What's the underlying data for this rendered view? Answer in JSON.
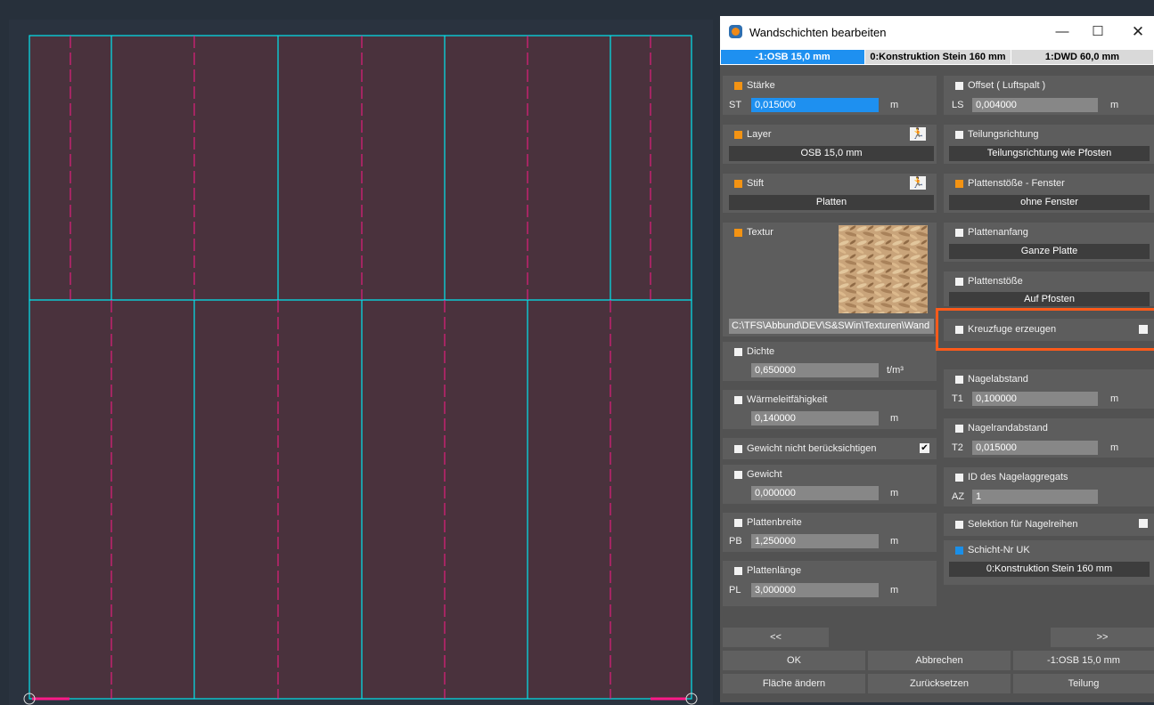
{
  "window": {
    "title": "Wandschichten bearbeiten",
    "minimize": "—",
    "maximize": "☐",
    "close": "✕"
  },
  "tabs": [
    {
      "label": "-1:OSB 15,0 mm",
      "active": true
    },
    {
      "label": "0:Konstruktion Stein 160 mm",
      "active": false
    },
    {
      "label": "1:DWD 60,0 mm",
      "active": false
    }
  ],
  "left": {
    "staerke": {
      "label": "Stärke",
      "prefix": "ST",
      "value": "0,015000",
      "unit": "m"
    },
    "layer": {
      "label": "Layer",
      "value": "OSB 15,0 mm"
    },
    "stift": {
      "label": "Stift",
      "value": "Platten"
    },
    "textur": {
      "label": "Textur",
      "path": "C:\\TFS\\Abbund\\DEV\\S&SWin\\Texturen\\Wand"
    },
    "dichte": {
      "label": "Dichte",
      "value": "0,650000",
      "unit": "t/m³"
    },
    "waerme": {
      "label": "Wärmeleitfähigkeit",
      "value": "0,140000",
      "unit": "m"
    },
    "gewicht_nicht": {
      "label": "Gewicht nicht berücksichtigen",
      "check": "✔"
    },
    "gewicht": {
      "label": "Gewicht",
      "value": "0,000000",
      "unit": "m"
    },
    "plattenbreite": {
      "label": "Plattenbreite",
      "prefix": "PB",
      "value": "1,250000",
      "unit": "m"
    },
    "plattenlaenge": {
      "label": "Plattenlänge",
      "prefix": "PL",
      "value": "3,000000",
      "unit": "m"
    }
  },
  "right": {
    "offset": {
      "label": "Offset ( Luftspalt )",
      "prefix": "LS",
      "value": "0,004000",
      "unit": "m"
    },
    "teilungsrichtung": {
      "label": "Teilungsrichtung",
      "value": "Teilungsrichtung wie Pfosten"
    },
    "plattenstoesse_fenster": {
      "label": "Plattenstöße - Fenster",
      "value": "ohne Fenster"
    },
    "plattenanfang": {
      "label": "Plattenanfang",
      "value": "Ganze Platte"
    },
    "plattenstoesse": {
      "label": "Plattenstöße",
      "value": "Auf Pfosten"
    },
    "kreuzfuge": {
      "label": "Kreuzfuge erzeugen"
    },
    "nagelabstand": {
      "label": "Nagelabstand",
      "prefix": "T1",
      "value": "0,100000",
      "unit": "m"
    },
    "nagelrandabstand": {
      "label": "Nagelrandabstand",
      "prefix": "T2",
      "value": "0,015000",
      "unit": "m"
    },
    "nagelaggregat": {
      "label": "ID des Nagelaggregats",
      "prefix": "AZ",
      "value": "1"
    },
    "selektion": {
      "label": "Selektion für Nagelreihen"
    },
    "schicht_nr": {
      "label": "Schicht-Nr UK",
      "value": "0:Konstruktion Stein 160 mm"
    }
  },
  "nav": {
    "prev": "<<",
    "next": ">>"
  },
  "buttons": {
    "ok": "OK",
    "abbrechen": "Abbrechen",
    "layer": "-1:OSB 15,0 mm",
    "flaeche": "Fläche ändern",
    "zuruecksetzen": "Zurücksetzen",
    "teilung": "Teilung"
  },
  "colors": {
    "panel_fill": "#4a323d",
    "panel_edge": "#00e5f0",
    "nail_line": "#ff1a88",
    "accent_blue": "#1e90f0",
    "accent_orange": "#f39313",
    "highlight": "#ff5a1a"
  }
}
